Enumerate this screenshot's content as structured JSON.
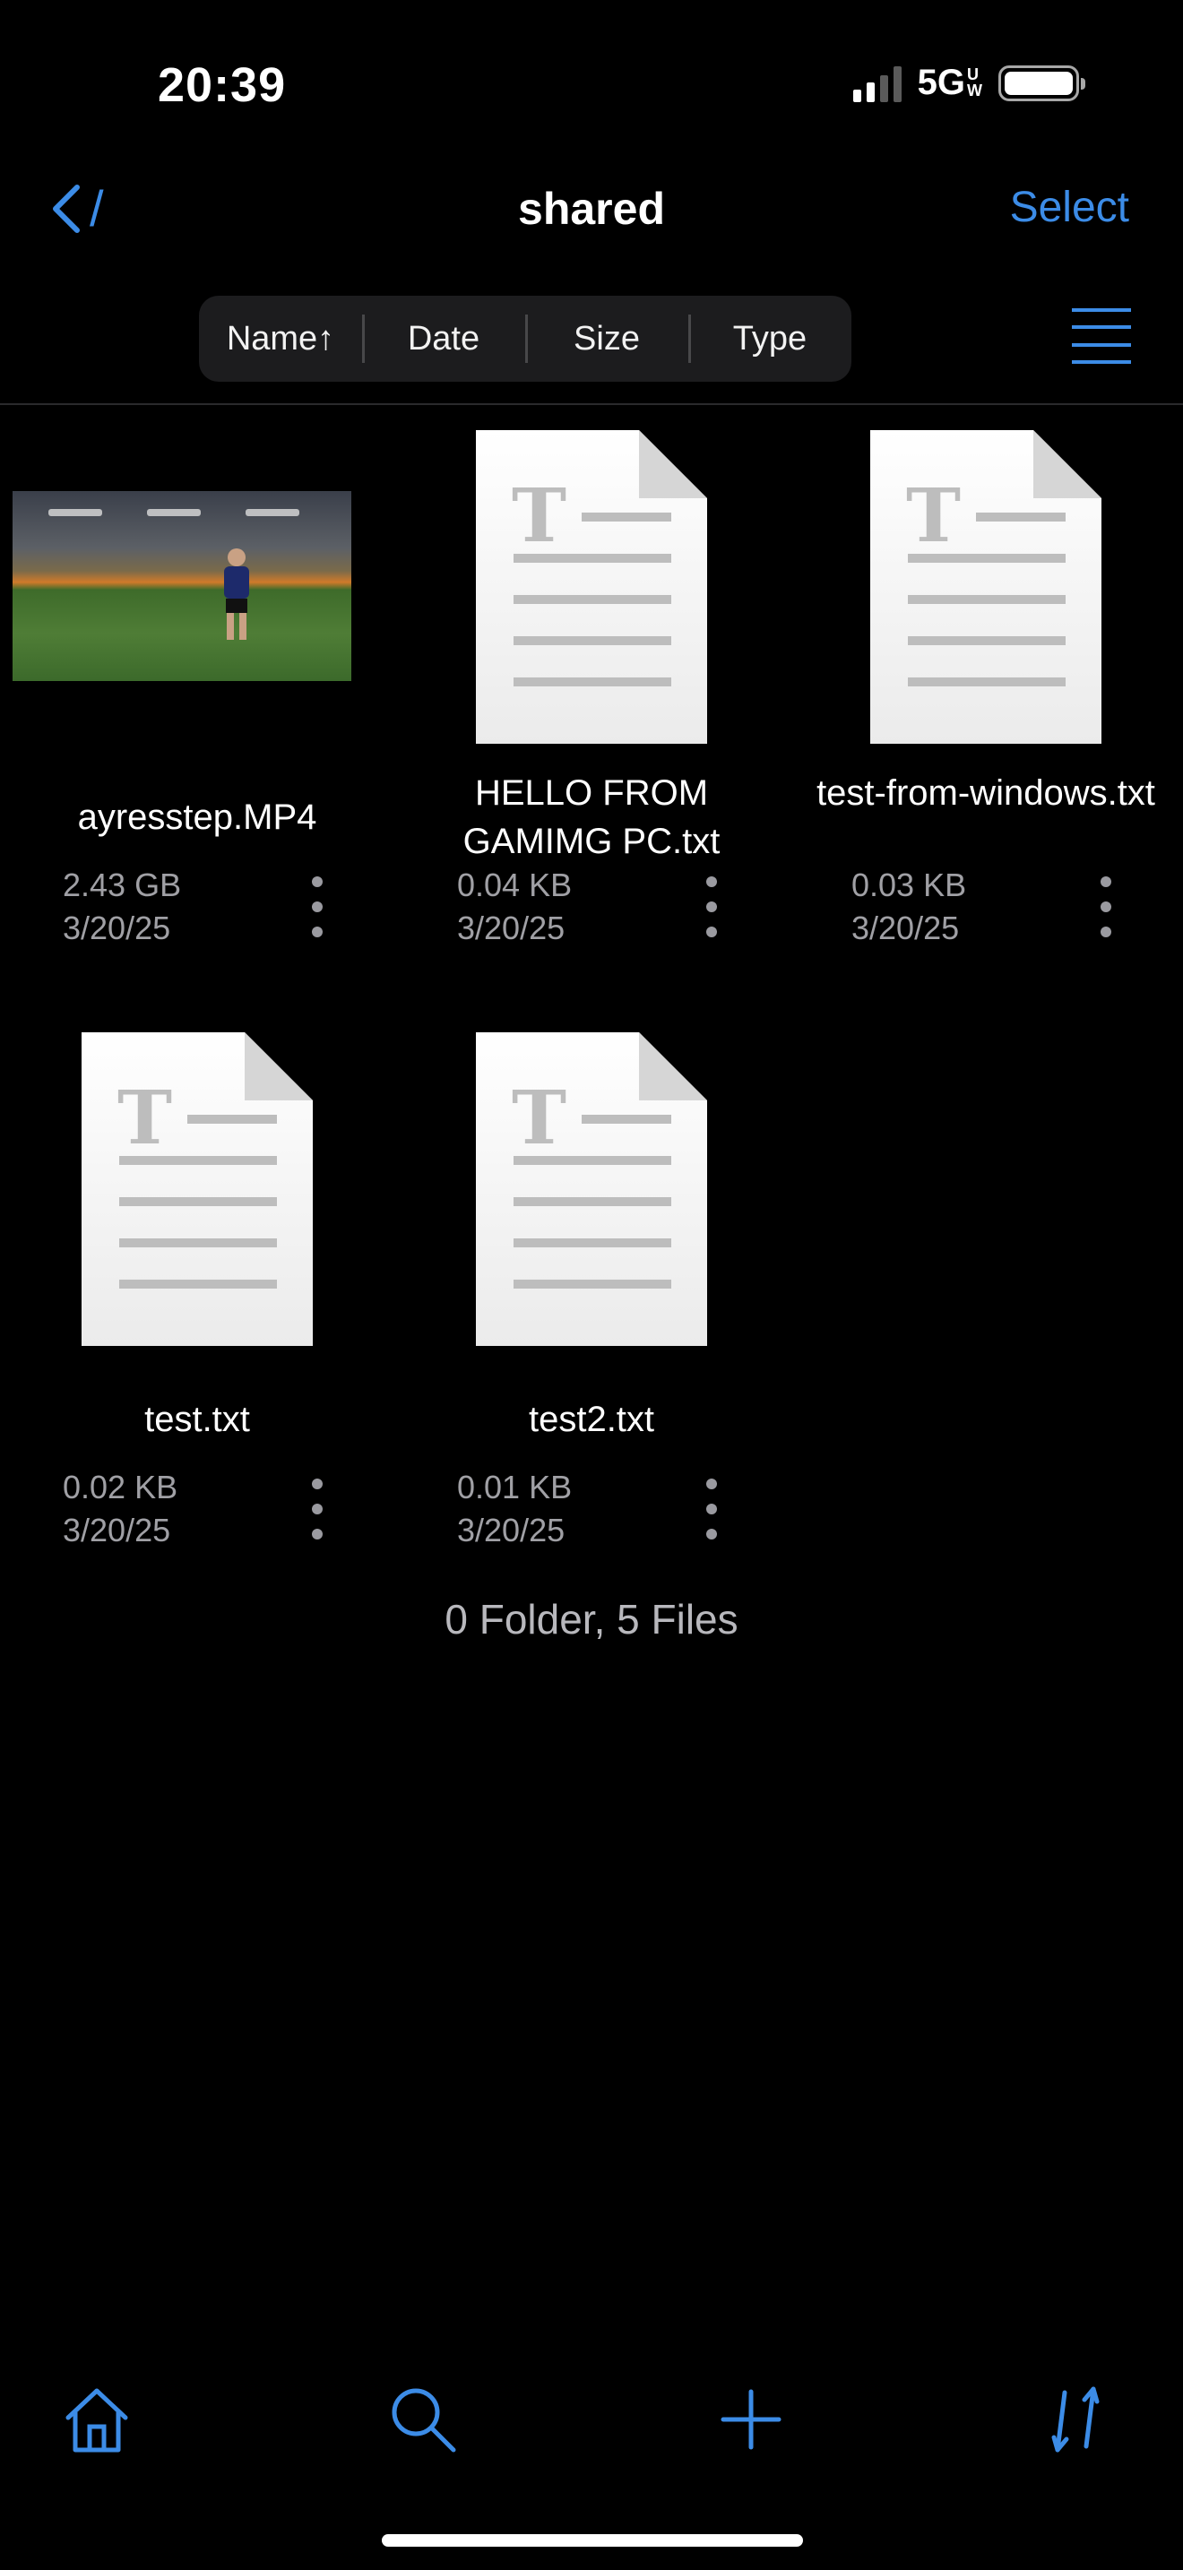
{
  "status_bar": {
    "time": "20:39",
    "network": "5G",
    "network_sub_top": "U",
    "network_sub_bottom": "W",
    "signal_bars_active": 2,
    "signal_bars_total": 4,
    "battery_level": 1.0
  },
  "nav": {
    "back_path": "/",
    "title": "shared",
    "select_label": "Select"
  },
  "sort": {
    "options": [
      "Name↑",
      "Date",
      "Size",
      "Type"
    ]
  },
  "files": [
    {
      "name": "ayresstep.MP4",
      "size": "2.43 GB",
      "date": "3/20/25",
      "kind": "video"
    },
    {
      "name": "HELLO FROM GAMIMG PC.txt",
      "size": "0.04 KB",
      "date": "3/20/25",
      "kind": "text"
    },
    {
      "name": "test-from-windows.txt",
      "size": "0.03 KB",
      "date": "3/20/25",
      "kind": "text"
    },
    {
      "name": "test.txt",
      "size": "0.02 KB",
      "date": "3/20/25",
      "kind": "text"
    },
    {
      "name": "test2.txt",
      "size": "0.01 KB",
      "date": "3/20/25",
      "kind": "text"
    }
  ],
  "summary": "0 Folder, 5 Files",
  "tabbar": {
    "icons": [
      "home-icon",
      "search-icon",
      "plus-icon",
      "sort-arrows-icon"
    ]
  },
  "colors": {
    "accent": "#3c8ce7",
    "background": "#000000",
    "secondary_text": "#a0a0a5"
  }
}
